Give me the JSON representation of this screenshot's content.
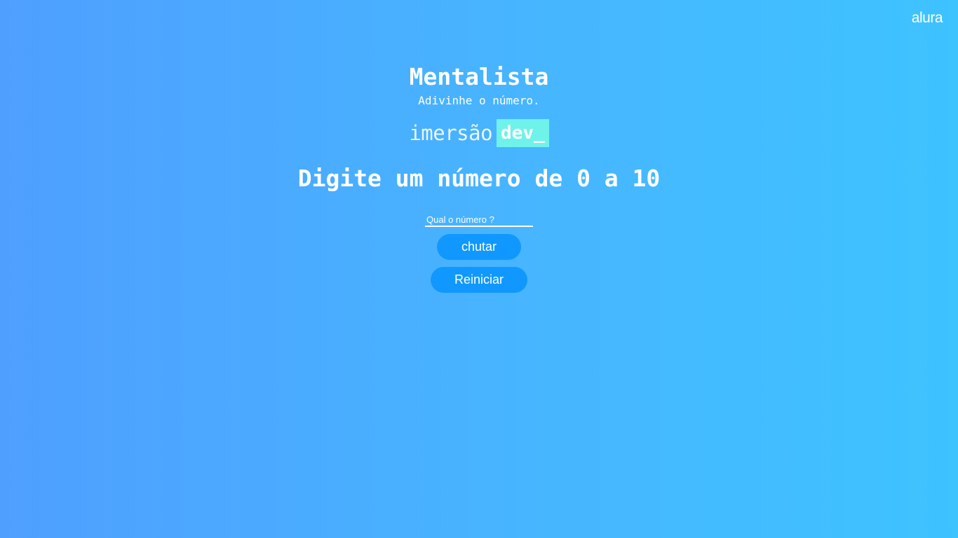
{
  "brand": {
    "logo_text": "alura"
  },
  "header": {
    "title": "Mentalista",
    "subtitle": "Adivinhe o número."
  },
  "event_logo": {
    "word": "imersão",
    "tag": "dev_",
    "tag_color": "#6ff2ea"
  },
  "game": {
    "instruction": "Digite um número de 0 a 10",
    "input_placeholder": "Qual o número ?",
    "input_value": "",
    "guess_button_label": "chutar",
    "restart_button_label": "Reiniciar"
  },
  "colors": {
    "background_start": "#4f9fff",
    "background_end": "#3ec3ff",
    "button": "#1098ff",
    "text": "#ffffff"
  }
}
